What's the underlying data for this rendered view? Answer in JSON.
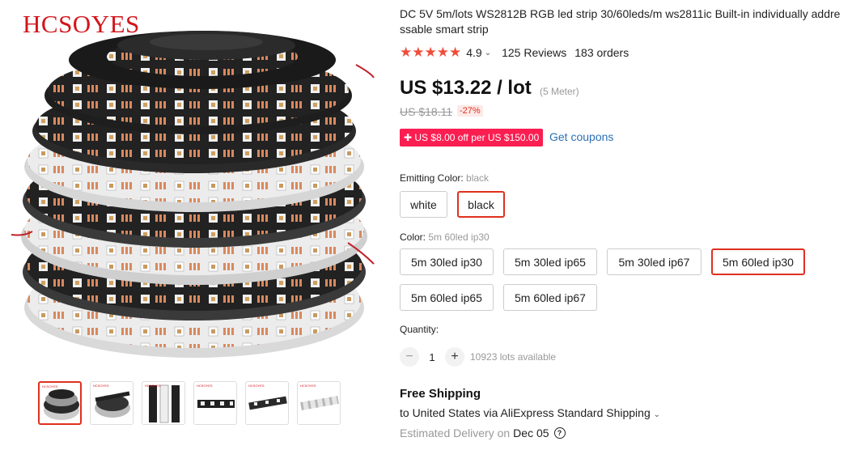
{
  "gallery": {
    "brand": "HCSOYES",
    "thumbnails": [
      {
        "name": "thumb-1"
      },
      {
        "name": "thumb-2"
      },
      {
        "name": "thumb-3"
      },
      {
        "name": "thumb-4"
      },
      {
        "name": "thumb-5"
      },
      {
        "name": "thumb-6"
      }
    ],
    "thumb_brand": "HCSOYES"
  },
  "product": {
    "title": "DC 5V 5m/lots WS2812B RGB led strip 30/60leds/m ws2811ic Built-in individually addressable smart strip",
    "rating": "4.9",
    "stars": 5,
    "reviews": "125 Reviews",
    "orders": "183 orders",
    "price": "US $13.22 / lot",
    "price_unit": "(5 Meter)",
    "original_price": "US $18.11",
    "discount": "-27%",
    "coupon": "US $8.00 off per US $150.00",
    "get_coupons": "Get coupons"
  },
  "emitting_color": {
    "label": "Emitting Color: ",
    "selected": "black",
    "options": [
      "white",
      "black"
    ]
  },
  "color": {
    "label": "Color: ",
    "selected": "5m 60led ip30",
    "options": [
      "5m 30led ip30",
      "5m 30led ip65",
      "5m 30led ip67",
      "5m 60led ip30",
      "5m 60led ip65",
      "5m 60led ip67"
    ]
  },
  "quantity": {
    "label": "Quantity:",
    "minus": "−",
    "value": "1",
    "plus": "+",
    "available": "10923 lots available"
  },
  "shipping": {
    "title": "Free Shipping",
    "to": "to United States via AliExpress Standard Shipping",
    "eta_label": "Estimated Delivery on",
    "eta_date": "Dec 05"
  },
  "colors": {
    "accent": "#e0301e",
    "star": "#f04c3b",
    "coupon_bg": "#fb1e51",
    "link": "#2a6fb6"
  }
}
